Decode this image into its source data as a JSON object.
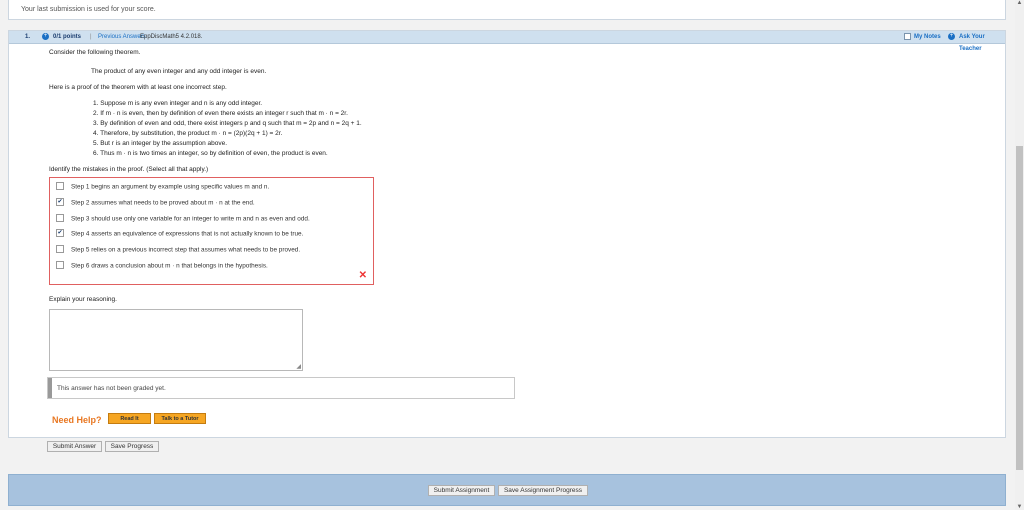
{
  "top_note": "Your last submission is used for your score.",
  "header": {
    "number": "1.",
    "points": "0/1 points",
    "separator": "|",
    "prev_answers": "Previous Answers",
    "assignment_id": "EppDiscMath5 4.2.018.",
    "my_notes": "My Notes",
    "ask_teacher": "Ask Your Teacher"
  },
  "question": {
    "intro": "Consider the following theorem.",
    "theorem": "The product of any even integer and any odd integer is even.",
    "proof_intro": "Here is a proof of the theorem with at least one incorrect step.",
    "steps": [
      "1. Suppose m is any even integer and n is any odd integer.",
      "2. If m · n is even, then by definition of even there exists an integer r such that m · n = 2r.",
      "3. By definition of even and odd, there exist integers p and q such that m = 2p and n = 2q + 1.",
      "4. Therefore, by substitution, the product m · n = (2p)(2q + 1) = 2r.",
      "5. But r is an integer by the assumption above.",
      "6. Thus m · n is two times an integer, so by definition of even, the product is even."
    ],
    "identify": "Identify the mistakes in the proof. (Select all that apply.)"
  },
  "choices": [
    {
      "label": "Step 1 begins an argument by example using specific values m and n.",
      "checked": false
    },
    {
      "label": "Step 2 assumes what needs to be proved about m · n at the end.",
      "checked": true
    },
    {
      "label": "Step 3 should use only one variable for an integer to write m and n as even and odd.",
      "checked": false
    },
    {
      "label": "Step 4 asserts an equivalence of expressions that is not actually known to be true.",
      "checked": true
    },
    {
      "label": "Step 5 relies on a previous incorrect step that assumes what needs to be proved.",
      "checked": false
    },
    {
      "label": "Step 6 draws a conclusion about m · n that belongs in the hypothesis.",
      "checked": false
    }
  ],
  "wrong_mark": "✕",
  "explain_label": "Explain your reasoning.",
  "reason_value": "",
  "graded_text": "This answer has not been graded yet.",
  "help": {
    "need_help": "Need Help?",
    "read_it": "Read It",
    "talk_to_tutor": "Talk to a Tutor"
  },
  "buttons": {
    "submit_answer": "Submit Answer",
    "save_progress": "Save Progress"
  },
  "footer": {
    "submit_assignment": "Submit Assignment",
    "save_assignment_progress": "Save Assignment Progress"
  },
  "colors": {
    "header_bg": "#cfe0ef",
    "link_blue": "#1a6fc4",
    "error_red": "#e06060",
    "help_orange": "#e87722",
    "footer_bg": "#a7c2de"
  }
}
